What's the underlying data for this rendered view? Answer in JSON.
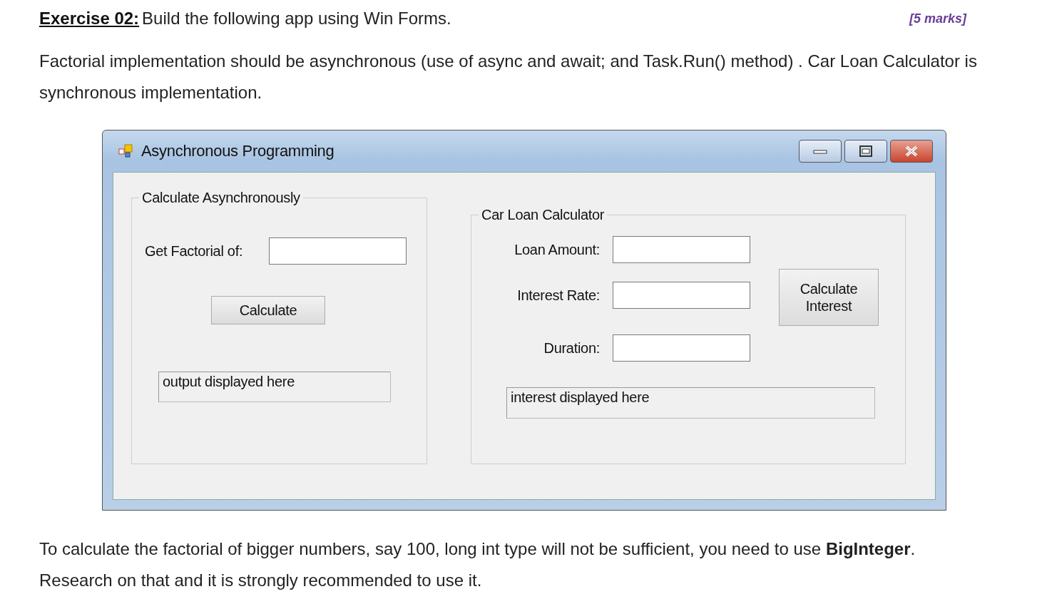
{
  "heading": {
    "label": "Exercise 02:",
    "text": "Build the following app using Win Forms.",
    "marks": "[5 marks]"
  },
  "intro": "Factorial implementation should be asynchronous (use of async and await; and Task.Run() method) . Car Loan Calculator is synchronous implementation.",
  "window": {
    "title": "Asynchronous Programming",
    "factorial_group": {
      "title": "Calculate Asynchronously",
      "label": "Get Factorial of:",
      "button": "Calculate",
      "output": "output displayed here"
    },
    "loan_group": {
      "title": "Car Loan Calculator",
      "fields": [
        {
          "label": "Loan Amount:"
        },
        {
          "label": "Interest Rate:"
        },
        {
          "label": "Duration:"
        }
      ],
      "button": "Calculate Interest",
      "output": "interest displayed here"
    }
  },
  "outro": "To calculate the factorial of bigger numbers, say 100, long int type will not be sufficient, you need to use **BigInteger**. Research on that and it is strongly recommended to use it."
}
